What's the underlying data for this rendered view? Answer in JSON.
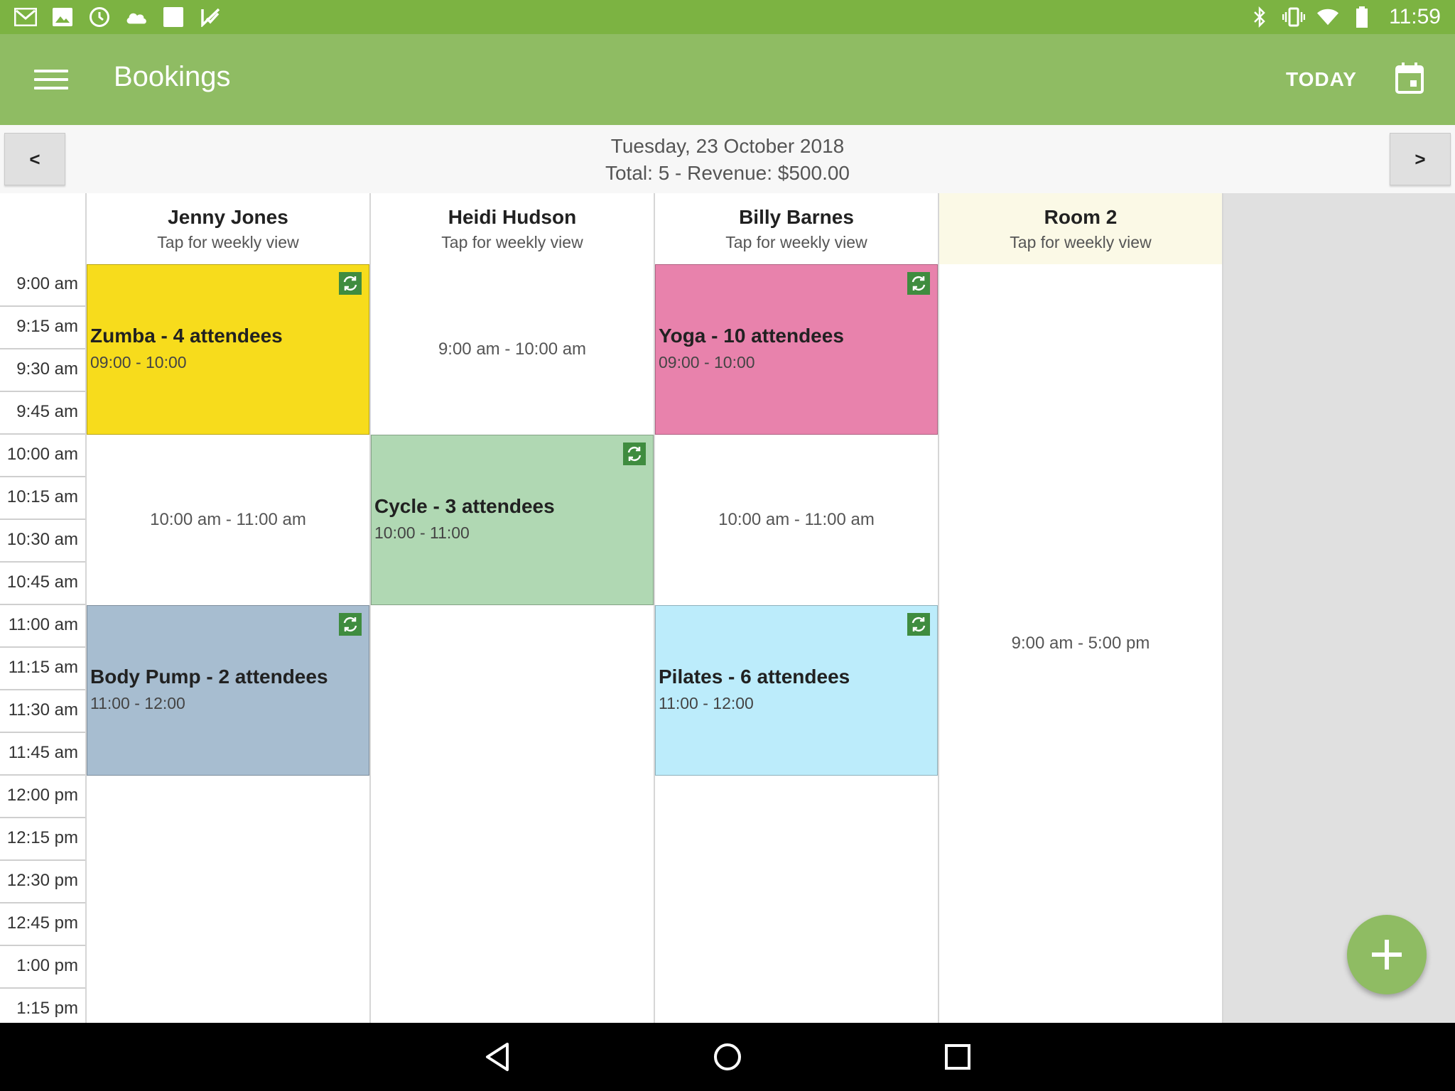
{
  "status_bar": {
    "left_icons": [
      "gmail-icon",
      "image-icon",
      "clock-icon",
      "cloud-icon",
      "square-icon",
      "check-flag-icon"
    ],
    "right_icons": [
      "bluetooth-icon",
      "vibrate-icon",
      "wifi-icon",
      "battery-icon"
    ],
    "time": "11:59"
  },
  "app_bar": {
    "title": "Bookings",
    "today_label": "TODAY",
    "accent_color": "#8fbc63"
  },
  "date_bar": {
    "prev_label": "<",
    "next_label": ">",
    "date": "Tuesday, 23 October 2018",
    "summary": "Total: 5 - Revenue: $500.00"
  },
  "time_slots": [
    "9:00 am",
    "9:15 am",
    "9:30 am",
    "9:45 am",
    "10:00 am",
    "10:15 am",
    "10:30 am",
    "10:45 am",
    "11:00 am",
    "11:15 am",
    "11:30 am",
    "11:45 am",
    "12:00 pm",
    "12:15 pm",
    "12:30 pm",
    "12:45 pm",
    "1:00 pm",
    "1:15 pm"
  ],
  "columns": [
    {
      "name": "Jenny Jones",
      "subtitle": "Tap for weekly view",
      "availability": [
        {
          "text": "10:00 am - 11:00 am"
        }
      ],
      "events": [
        {
          "title": "Zumba - 4 attendees",
          "time": "09:00 - 10:00",
          "color": "#f7dc1c",
          "recurring": true
        },
        {
          "title": "Body Pump - 2 attendees",
          "time": "11:00 - 12:00",
          "color": "#a7bdd0",
          "recurring": true
        }
      ]
    },
    {
      "name": "Heidi Hudson",
      "subtitle": "Tap for weekly view",
      "availability": [
        {
          "text": "9:00 am - 10:00 am"
        }
      ],
      "events": [
        {
          "title": "Cycle - 3 attendees",
          "time": "10:00 - 11:00",
          "color": "#b0d8b3",
          "recurring": true
        }
      ]
    },
    {
      "name": "Billy Barnes",
      "subtitle": "Tap for weekly view",
      "availability": [
        {
          "text": "10:00 am - 11:00 am"
        }
      ],
      "events": [
        {
          "title": "Yoga - 10 attendees",
          "time": "09:00 - 10:00",
          "color": "#e882ac",
          "recurring": true
        },
        {
          "title": "Pilates - 6 attendees",
          "time": "11:00 - 12:00",
          "color": "#bcecfb",
          "recurring": true
        }
      ]
    },
    {
      "name": "Room 2",
      "subtitle": "Tap for weekly view",
      "availability": [
        {
          "text": "9:00 am - 5:00 pm"
        }
      ],
      "events": []
    }
  ],
  "fab_icon": "plus-icon",
  "nav_bar": {
    "icons": [
      "back-icon",
      "home-icon",
      "recents-icon"
    ]
  }
}
